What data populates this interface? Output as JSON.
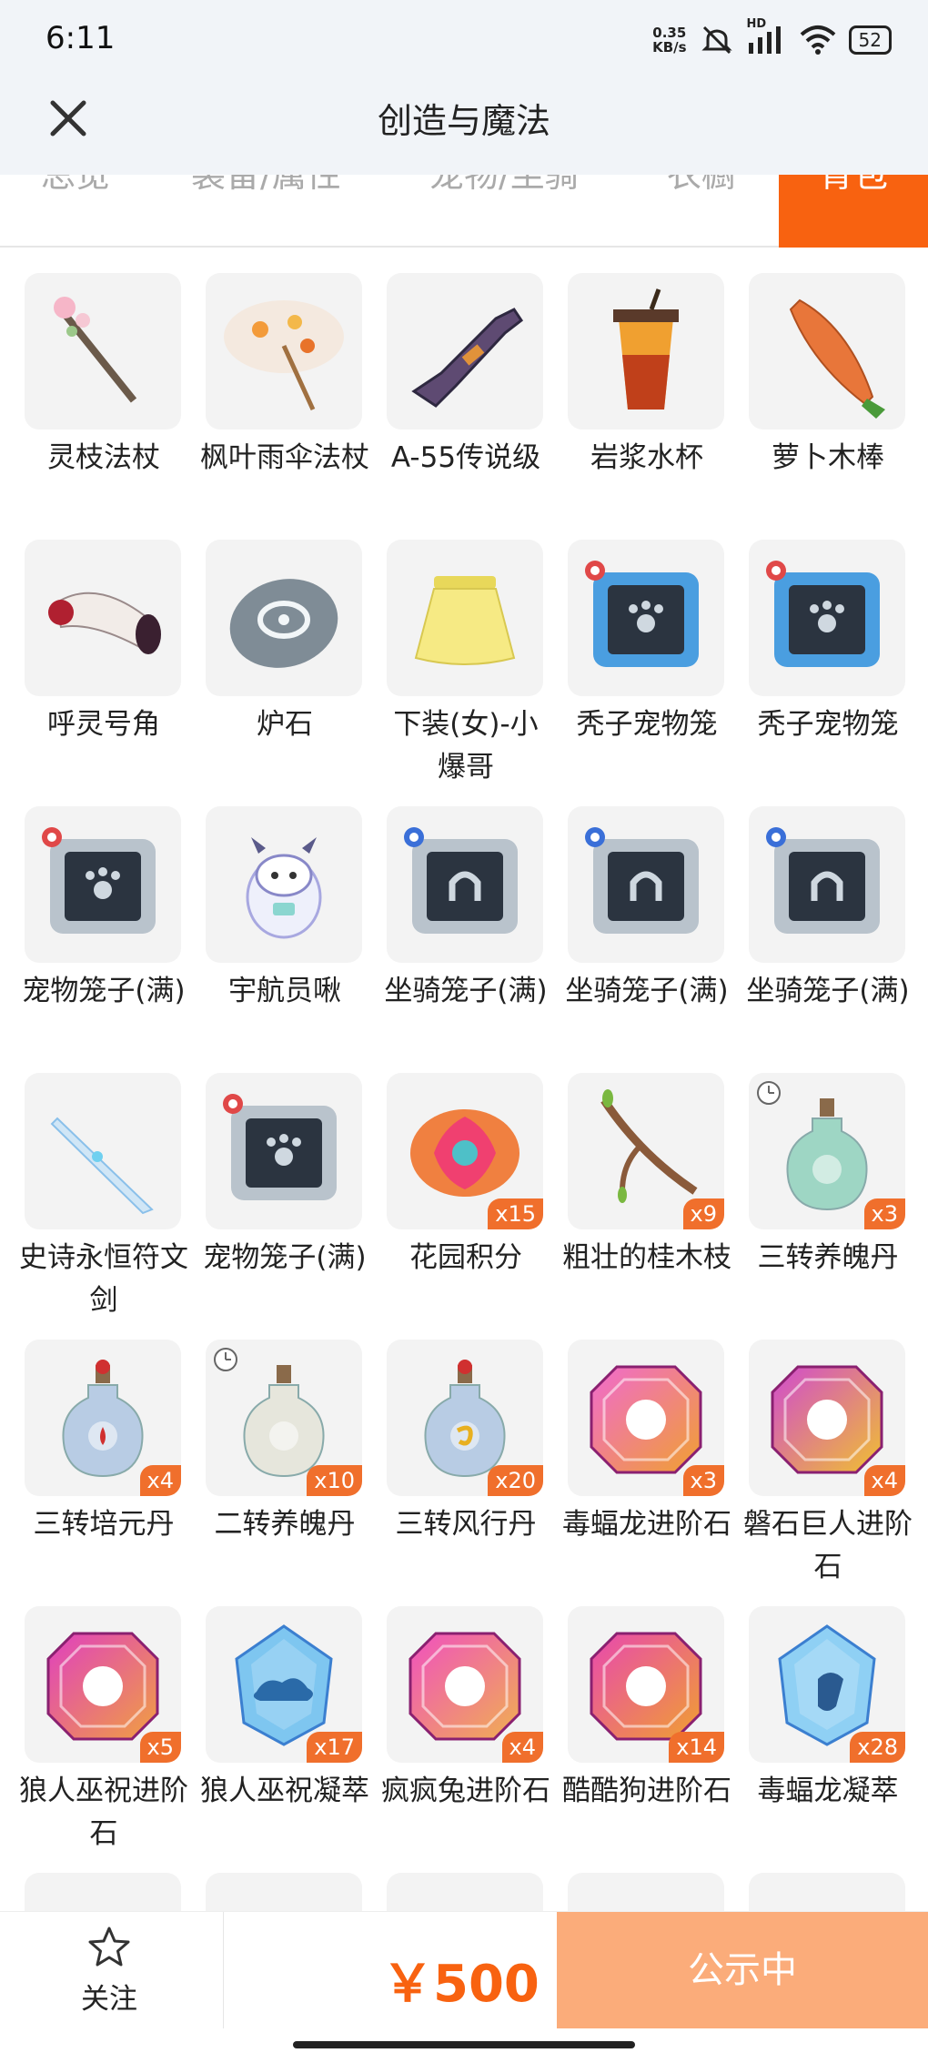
{
  "status_bar": {
    "time": "6:11",
    "speed_value": "0.35",
    "speed_unit": "KB/s",
    "hd": "HD",
    "battery": "52"
  },
  "header": {
    "title": "创造与魔法"
  },
  "tabs": [
    {
      "label": "总览"
    },
    {
      "label": "装备/属性"
    },
    {
      "label": "宠物/坐骑"
    },
    {
      "label": "衣橱"
    },
    {
      "label": "背包"
    }
  ],
  "active_tab": "背包",
  "items": [
    {
      "name": "灵枝法杖",
      "icon": "spirit-branch-staff-icon"
    },
    {
      "name": "枫叶雨伞法杖",
      "icon": "maple-umbrella-staff-icon"
    },
    {
      "name": "A-55传说级",
      "icon": "a55-gun-icon"
    },
    {
      "name": "岩浆水杯",
      "icon": "lava-cup-icon"
    },
    {
      "name": "萝卜木棒",
      "icon": "carrot-stick-icon"
    },
    {
      "name": "呼灵号角",
      "icon": "horn-icon"
    },
    {
      "name": "炉石",
      "icon": "hearthstone-icon"
    },
    {
      "name": "下装(女)-小爆哥",
      "icon": "yellow-skirt-icon"
    },
    {
      "name": "秃子宠物笼",
      "icon": "pet-cage-blue-icon"
    },
    {
      "name": "秃子宠物笼",
      "icon": "pet-cage-blue-icon"
    },
    {
      "name": "宠物笼子(满)",
      "icon": "pet-cage-full-icon"
    },
    {
      "name": "宇航员啾",
      "icon": "astronaut-pet-icon"
    },
    {
      "name": "坐骑笼子(满)",
      "icon": "mount-cage-icon"
    },
    {
      "name": "坐骑笼子(满)",
      "icon": "mount-cage-icon"
    },
    {
      "name": "坐骑笼子(满)",
      "icon": "mount-cage-icon"
    },
    {
      "name": "史诗永恒符文剑",
      "icon": "crystal-sword-icon"
    },
    {
      "name": "宠物笼子(满)",
      "icon": "pet-cage-full-icon"
    },
    {
      "name": "花园积分",
      "icon": "garden-points-icon",
      "count": "x15"
    },
    {
      "name": "粗壮的桂木枝",
      "icon": "osmanthus-branch-icon",
      "count": "x9"
    },
    {
      "name": "三转养魄丹",
      "icon": "green-potion-icon",
      "count": "x3"
    },
    {
      "name": "三转培元丹",
      "icon": "red-potion-icon",
      "count": "x4"
    },
    {
      "name": "二转养魄丹",
      "icon": "white-vase-icon",
      "count": "x10"
    },
    {
      "name": "三转风行丹",
      "icon": "wind-potion-icon",
      "count": "x20"
    },
    {
      "name": "毒蝠龙进阶石",
      "icon": "bat-dragon-gem-icon",
      "count": "x3"
    },
    {
      "name": "磐石巨人进阶石",
      "icon": "rock-giant-gem-icon",
      "count": "x4"
    },
    {
      "name": "狼人巫祝进阶石",
      "icon": "werewolf-gem-icon",
      "count": "x5"
    },
    {
      "name": "狼人巫祝凝萃",
      "icon": "werewolf-crystal-icon",
      "count": "x17"
    },
    {
      "name": "疯疯兔进阶石",
      "icon": "crazy-rabbit-gem-icon",
      "count": "x4"
    },
    {
      "name": "酷酷狗进阶石",
      "icon": "cool-dog-gem-icon",
      "count": "x14"
    },
    {
      "name": "毒蝠龙凝萃",
      "icon": "bat-dragon-crystal-icon",
      "count": "x28"
    }
  ],
  "bottom": {
    "follow_label": "关注",
    "price": "￥500",
    "buy_label": "公示中"
  },
  "colors": {
    "accent": "#f86210",
    "buy_button": "#fbac7a",
    "count_badge": "#f06f2c"
  }
}
